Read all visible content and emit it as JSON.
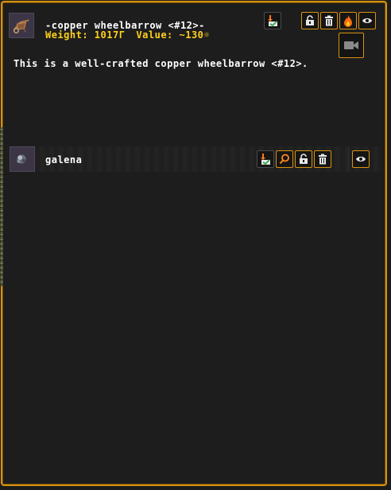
{
  "item": {
    "title": "-copper wheelbarrow <#12>-",
    "weight": "Weight: 1017Г",
    "value": "Value: ~130☼",
    "description": "This is a well-crafted copper wheelbarrow <#12>."
  },
  "contents": [
    {
      "name": "galena"
    }
  ],
  "colors": {
    "accent": "#d9930f",
    "meta_text": "#ffd11a",
    "panel_bg": "#1d1d1d",
    "text": "#ffffff"
  },
  "icons": {
    "item_thumb": "wheelbarrow-icon",
    "content_thumb": "galena-ore-icon",
    "buttons": [
      "dump-icon",
      "unlock-icon",
      "trash-icon",
      "fire-icon",
      "eye-icon",
      "camera-icon",
      "dump-icon",
      "magnifier-icon",
      "unlock-icon",
      "trash-icon",
      "eye-icon"
    ]
  }
}
